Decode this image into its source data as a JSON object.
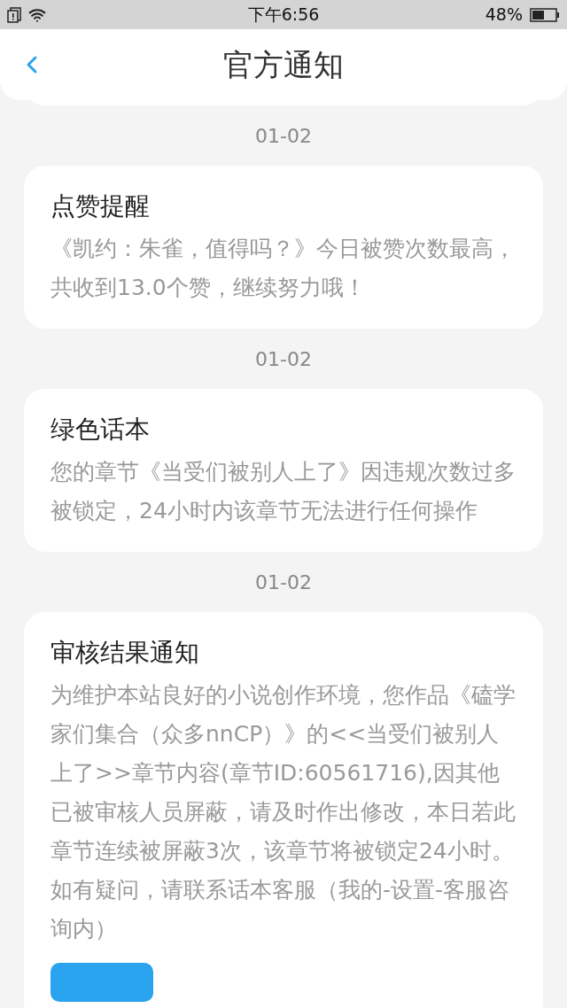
{
  "status_bar": {
    "time": "下午6:56",
    "battery": "48%"
  },
  "header": {
    "title": "官方通知"
  },
  "notifications": [
    {
      "date": "01-02",
      "title": "点赞提醒",
      "body": "《凯约：朱雀，值得吗？》今日被赞次数最高，共收到13.0个赞，继续努力哦！"
    },
    {
      "date": "01-02",
      "title": "绿色话本",
      "body": "您的章节《当受们被别人上了》因违规次数过多被锁定，24小时内该章节无法进行任何操作"
    },
    {
      "date": "01-02",
      "title": "审核结果通知",
      "body": "为维护本站良好的小说创作环境，您作品《磕学家们集合（众多nnCP）》的<<当受们被别人上了>>章节内容(章节ID:60561716),因其他已被审核人员屏蔽，请及时作出修改，本日若此章节连续被屏蔽3次，该章节将被锁定24小时。如有疑问，请联系话本客服（我的-设置-客服咨询内）",
      "has_action": true
    }
  ]
}
